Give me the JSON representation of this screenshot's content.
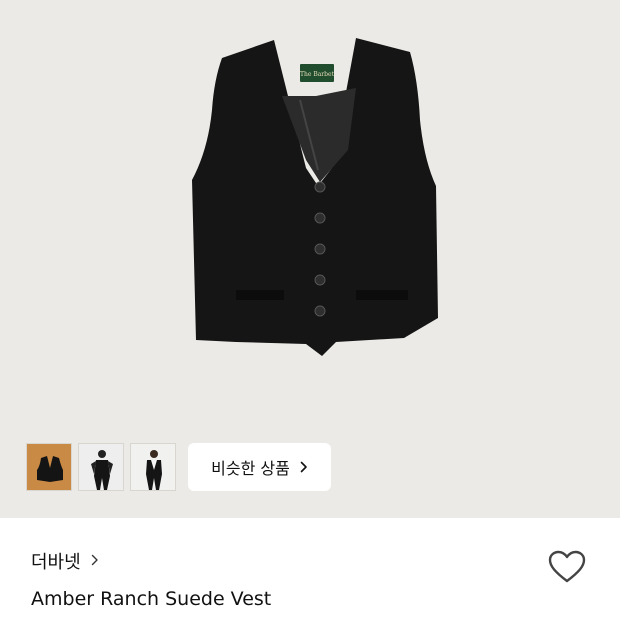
{
  "colors": {
    "hero_background": "#eceae6",
    "vest": "#151515",
    "lining": "#2b2b2b",
    "label_green": "#1f4d2e"
  },
  "hero": {
    "label_text": "The Barbet"
  },
  "gallery": {
    "thumbnails": [
      {
        "name": "vest-flat",
        "selected": true
      },
      {
        "name": "model-full"
      },
      {
        "name": "model-front"
      }
    ],
    "similar_button": {
      "label": "비슷한 상품",
      "icon": "chevron-right-icon"
    }
  },
  "product": {
    "brand": "더바넷",
    "brand_icon": "chevron-right-icon",
    "name": "Amber Ranch Suede Vest",
    "wishlist_icon": "heart-outline-icon"
  }
}
